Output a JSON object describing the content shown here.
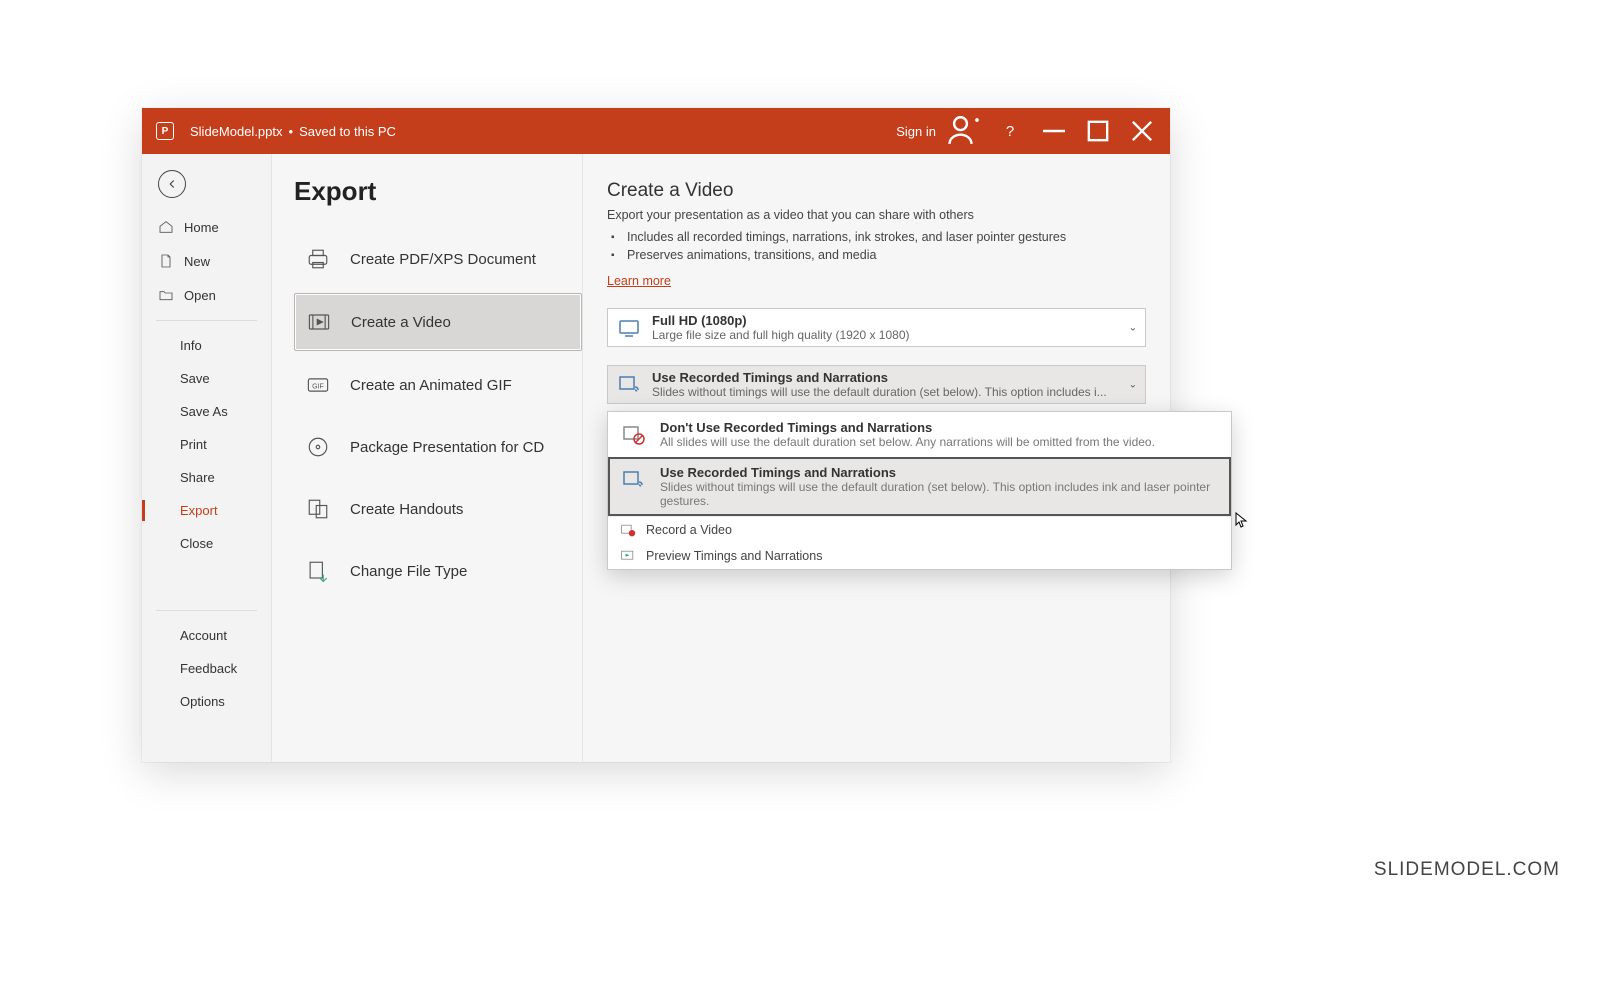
{
  "titlebar": {
    "filename": "SlideModel.pptx",
    "savestatus": "Saved to this PC",
    "signin": "Sign in"
  },
  "sidebar": {
    "home": "Home",
    "new": "New",
    "open": "Open",
    "info": "Info",
    "save": "Save",
    "saveas": "Save As",
    "print": "Print",
    "share": "Share",
    "export": "Export",
    "close": "Close",
    "account": "Account",
    "feedback": "Feedback",
    "options": "Options"
  },
  "export": {
    "heading": "Export",
    "items": {
      "pdf": "Create PDF/XPS Document",
      "video": "Create a Video",
      "gif": "Create an Animated GIF",
      "cd": "Package Presentation for CD",
      "handouts": "Create Handouts",
      "filetype": "Change File Type"
    }
  },
  "detail": {
    "heading": "Create a Video",
    "sub": "Export your presentation as a video that you can share with others",
    "bullets": [
      "Includes all recorded timings, narrations, ink strokes, and laser pointer gestures",
      "Preserves animations, transitions, and media"
    ],
    "learn": "Learn more",
    "quality": {
      "title": "Full HD (1080p)",
      "sub": "Large file size and full high quality (1920 x 1080)"
    },
    "timings": {
      "title": "Use Recorded Timings and Narrations",
      "sub": "Slides without timings will use the default duration (set below). This option includes i..."
    },
    "dropdown": {
      "opt1": {
        "title": "Don't Use Recorded Timings and Narrations",
        "sub": "All slides will use the default duration set below. Any narrations will be omitted from the video."
      },
      "opt2": {
        "title": "Use Recorded Timings and Narrations",
        "sub": "Slides without timings will use the default duration (set below). This option includes ink and laser pointer gestures."
      },
      "record": "Record a Video",
      "preview": "Preview Timings and Narrations"
    }
  },
  "watermark": "SLIDEMODEL.COM"
}
